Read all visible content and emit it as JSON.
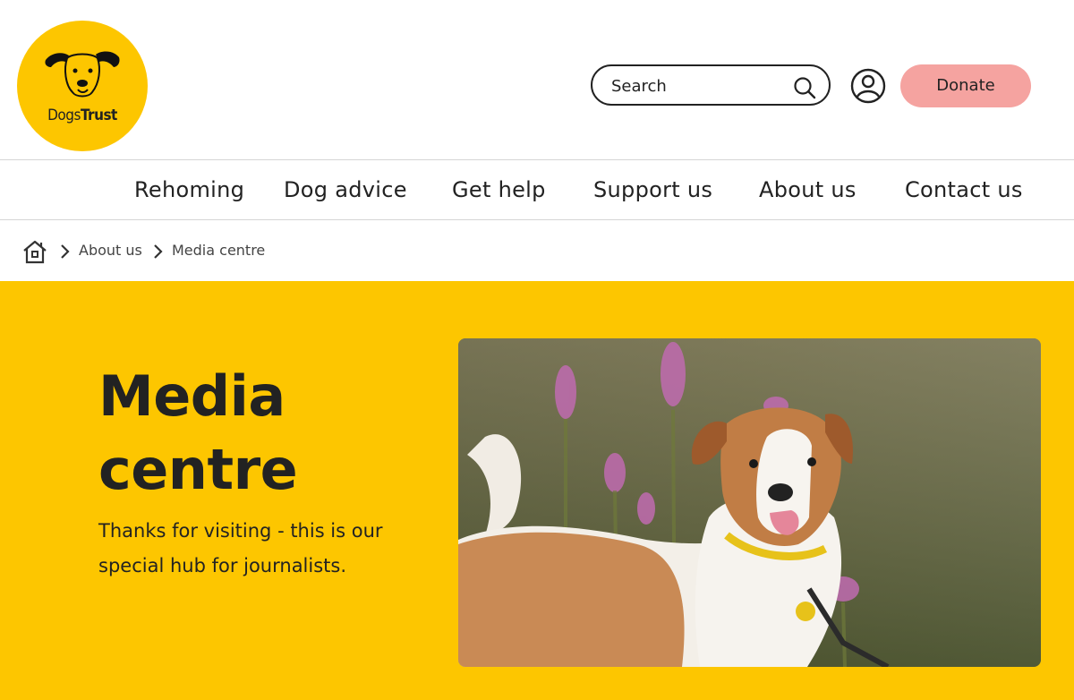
{
  "brand": {
    "name_light": "Dogs",
    "name_bold": "Trust",
    "color": "#fdc600"
  },
  "header": {
    "search_placeholder": "Search",
    "donate_label": "Donate",
    "donate_color": "#f5a3a0"
  },
  "nav": {
    "items": [
      {
        "label": "Rehoming"
      },
      {
        "label": "Dog advice"
      },
      {
        "label": "Get help"
      },
      {
        "label": "Support us"
      },
      {
        "label": "About us"
      },
      {
        "label": "Contact us"
      }
    ]
  },
  "breadcrumb": {
    "items": [
      "About us",
      "Media centre"
    ]
  },
  "hero": {
    "title_line1": "Media",
    "title_line2": "centre",
    "subtitle": "Thanks for visiting - this is our special hub for journalists."
  }
}
